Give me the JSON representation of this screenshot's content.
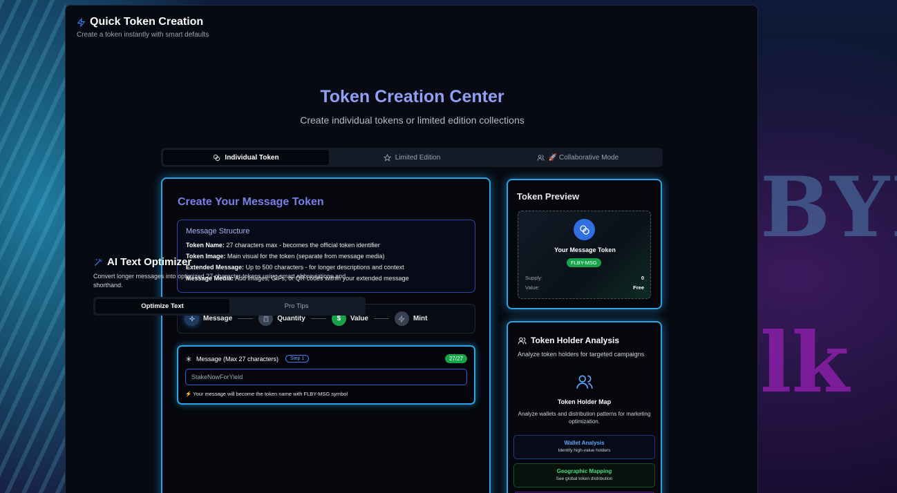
{
  "app": {
    "title": "Quick Token Creation",
    "subtitle": "Create a token instantly with smart defaults",
    "title_icon": "bolt-icon"
  },
  "background": {
    "art_text_1": "BYI",
    "art_text_2": "lk"
  },
  "center": {
    "title": "Token Creation Center",
    "subtitle": "Create individual tokens or limited edition collections"
  },
  "mode_tabs": [
    {
      "label": "Individual Token",
      "icon": "coins-icon",
      "active": true
    },
    {
      "label": "Limited Edition",
      "icon": "star-icon",
      "active": false
    },
    {
      "label": "🚀 Collaborative Mode",
      "icon": "users-icon",
      "active": false
    }
  ],
  "create": {
    "title": "Create Your Message Token",
    "structure": {
      "heading": "Message Structure",
      "rows": [
        {
          "label": "Token Name:",
          "text": " 27 characters max - becomes the official token identifier"
        },
        {
          "label": "Token Image:",
          "text": " Main visual for the token (separate from message media)"
        },
        {
          "label": "Extended Message:",
          "text": " Up to 500 characters - for longer descriptions and context"
        },
        {
          "label": "Message Media:",
          "text": " Add images, GIFs, or QR codes within your extended message"
        }
      ]
    },
    "steps": [
      {
        "label": "Message",
        "icon": "sparkles-icon",
        "color": "#1e3a5f"
      },
      {
        "label": "Quantity",
        "icon": "calculator-icon",
        "color": "#374151"
      },
      {
        "label": "Value",
        "icon": "dollar-icon",
        "color": "#16a34a"
      },
      {
        "label": "Mint",
        "icon": "bolt-icon",
        "color": "#374151"
      }
    ],
    "message": {
      "label": "Message (Max 27 characters)",
      "step_badge": "Step 1",
      "count": "27/27",
      "value": "StakeNowForYield",
      "hint": "⚡ Your message will become the token name with FLBY-MSG symbol"
    }
  },
  "ai": {
    "title": "AI Text Optimizer",
    "description": "Convert longer messages into optimized 27-character tokens using smart abbreviations and shorthand.",
    "tabs": [
      "Optimize Text",
      "Pro Tips"
    ]
  },
  "preview": {
    "title": "Token Preview",
    "token_name": "Your Message Token",
    "symbol": "FLBY-MSG",
    "supply_label": "Supply:",
    "supply_value": "0",
    "value_label": "Value:",
    "value_value": "Free"
  },
  "holders": {
    "title": "Token Holder Analysis",
    "subtitle": "Analyze token holders for targeted campaigns",
    "map_title": "Token Holder Map",
    "map_desc": "Analyze wallets and distribution patterns for marketing optimization.",
    "features": [
      {
        "title": "Wallet Analysis",
        "sub": "Identify high-value holders",
        "color": "#60a5fa"
      },
      {
        "title": "Geographic Mapping",
        "sub": "See global token distribution",
        "color": "#4ade80"
      }
    ]
  },
  "colors": {
    "accent_cyan": "#2aa6e8",
    "title_indigo": "#8fa0f5",
    "success_green": "#16a34a"
  }
}
